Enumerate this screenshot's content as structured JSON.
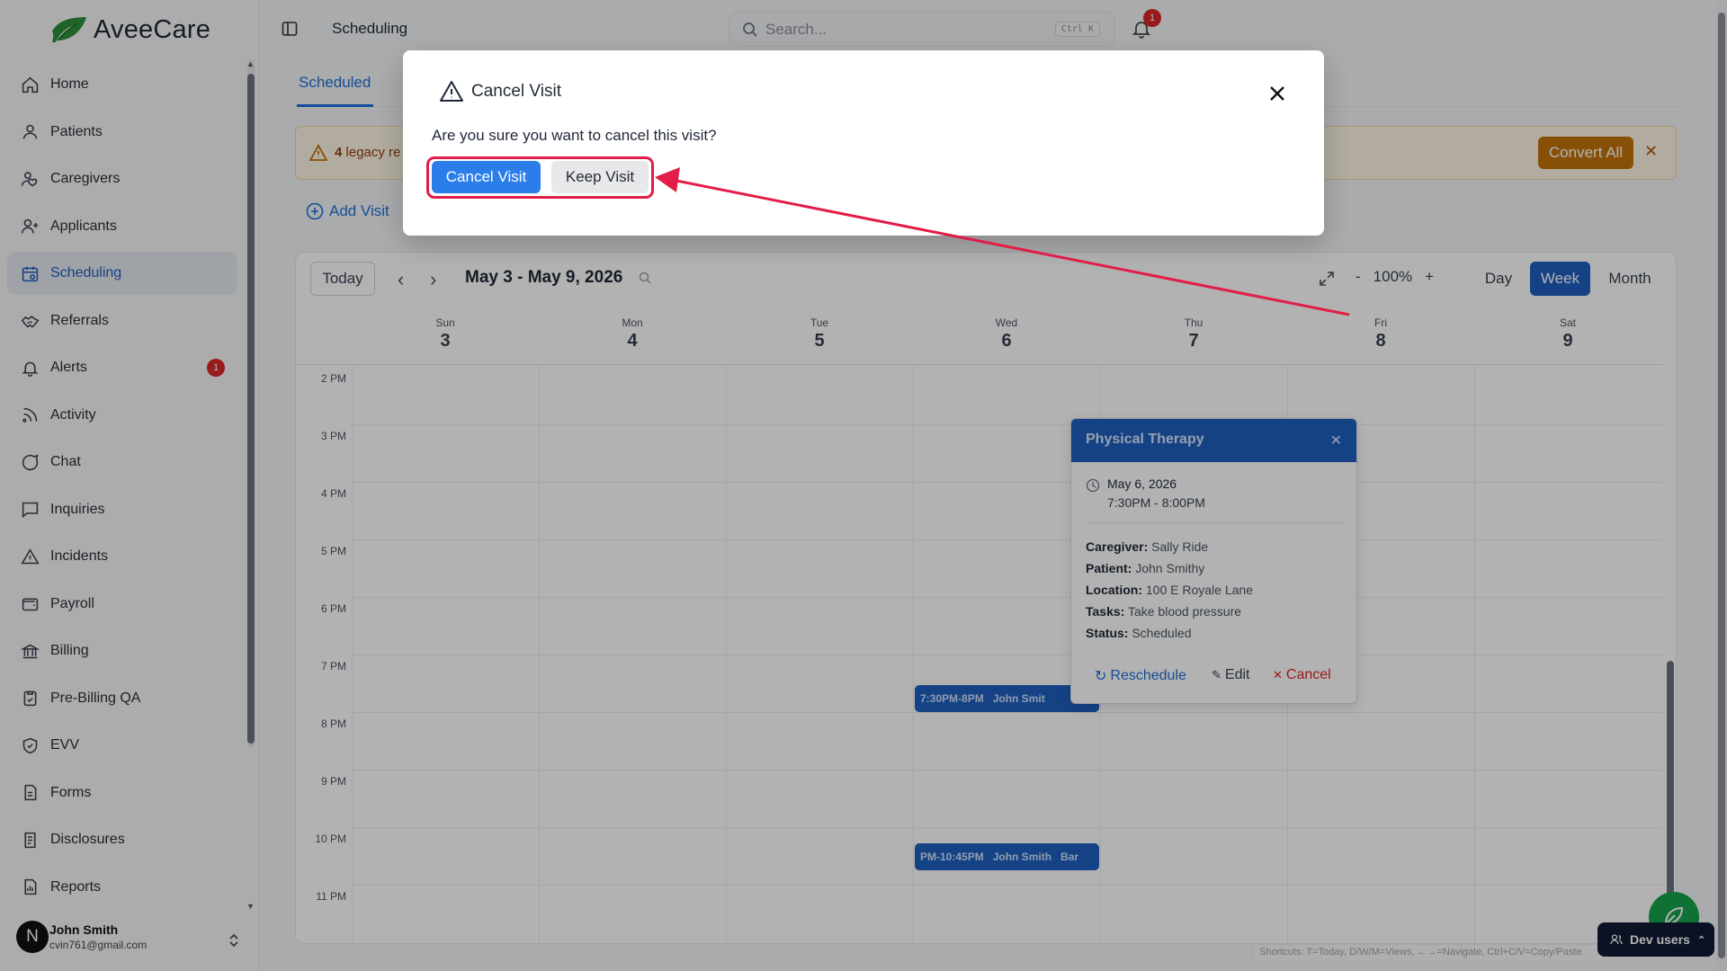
{
  "app": {
    "name": "AveeCare"
  },
  "sidebar": {
    "items": [
      {
        "label": "Home",
        "icon": "home-icon"
      },
      {
        "label": "Patients",
        "icon": "user-icon"
      },
      {
        "label": "Caregivers",
        "icon": "caregivers-icon"
      },
      {
        "label": "Applicants",
        "icon": "user-plus-icon"
      },
      {
        "label": "Scheduling",
        "icon": "calendar-icon",
        "active": true
      },
      {
        "label": "Referrals",
        "icon": "handshake-icon"
      },
      {
        "label": "Alerts",
        "icon": "bell-icon",
        "badge": "1"
      },
      {
        "label": "Activity",
        "icon": "rss-icon"
      },
      {
        "label": "Chat",
        "icon": "chat-icon"
      },
      {
        "label": "Inquiries",
        "icon": "message-square-icon"
      },
      {
        "label": "Incidents",
        "icon": "warning-icon"
      },
      {
        "label": "Payroll",
        "icon": "wallet-icon"
      },
      {
        "label": "Billing",
        "icon": "bank-icon"
      },
      {
        "label": "Pre-Billing QA",
        "icon": "clipboard-check-icon"
      },
      {
        "label": "EVV",
        "icon": "shield-check-icon"
      },
      {
        "label": "Forms",
        "icon": "file-icon"
      },
      {
        "label": "Disclosures",
        "icon": "document-icon"
      },
      {
        "label": "Reports",
        "icon": "report-icon"
      }
    ],
    "user": {
      "initial": "N",
      "name": "John Smith",
      "email": "cvin761@gmail.com"
    }
  },
  "topbar": {
    "title": "Scheduling",
    "search_placeholder": "Search...",
    "search_shortcut": "Ctrl K",
    "notification_count": "1"
  },
  "main": {
    "tab_active": "Scheduled",
    "legacy_banner": {
      "count": "4",
      "text": "legacy re",
      "action": "Convert All"
    },
    "add_visit": "Add Visit"
  },
  "calendar": {
    "today_label": "Today",
    "range": "May 3 - May 9, 2026",
    "zoom_minus": "-",
    "zoom": "100%",
    "zoom_plus": "+",
    "views": [
      "Day",
      "Week",
      "Month"
    ],
    "active_view": "Week",
    "days": [
      {
        "name": "Sun",
        "num": "3"
      },
      {
        "name": "Mon",
        "num": "4"
      },
      {
        "name": "Tue",
        "num": "5"
      },
      {
        "name": "Wed",
        "num": "6"
      },
      {
        "name": "Thu",
        "num": "7"
      },
      {
        "name": "Fri",
        "num": "8"
      },
      {
        "name": "Sat",
        "num": "9"
      }
    ],
    "hours": [
      "2 PM",
      "3 PM",
      "4 PM",
      "5 PM",
      "6 PM",
      "7 PM",
      "8 PM",
      "9 PM",
      "10 PM",
      "11 PM"
    ],
    "events": [
      {
        "time": "7:30PM-8PM",
        "who": "John Smit"
      },
      {
        "time": "PM-10:45PM",
        "who": "John Smith",
        "extra": "Bar"
      }
    ]
  },
  "popover": {
    "title": "Physical Therapy",
    "date": "May 6, 2026",
    "time": "7:30PM - 8:00PM",
    "caregiver_label": "Caregiver:",
    "caregiver": "Sally Ride",
    "patient_label": "Patient:",
    "patient": "John Smithy",
    "location_label": "Location:",
    "location": "100 E Royale Lane",
    "tasks_label": "Tasks:",
    "tasks": "Take blood pressure",
    "status_label": "Status:",
    "status": "Scheduled",
    "reschedule": "Reschedule",
    "edit": "Edit",
    "cancel": "Cancel"
  },
  "modal": {
    "title": "Cancel Visit",
    "message": "Are you sure you want to cancel this visit?",
    "confirm": "Cancel Visit",
    "keep": "Keep Visit"
  },
  "footer": {
    "shortcuts": "Shortcuts: T=Today, D/W/M=Views, ←→=Navigate, Ctrl+C/V=Copy/Paste",
    "dev_users": "Dev users"
  },
  "colors": {
    "accent": "#1e5fbf",
    "primary_button": "#2b7de9",
    "highlight": "#e11d48",
    "warning": "#c2730b"
  }
}
